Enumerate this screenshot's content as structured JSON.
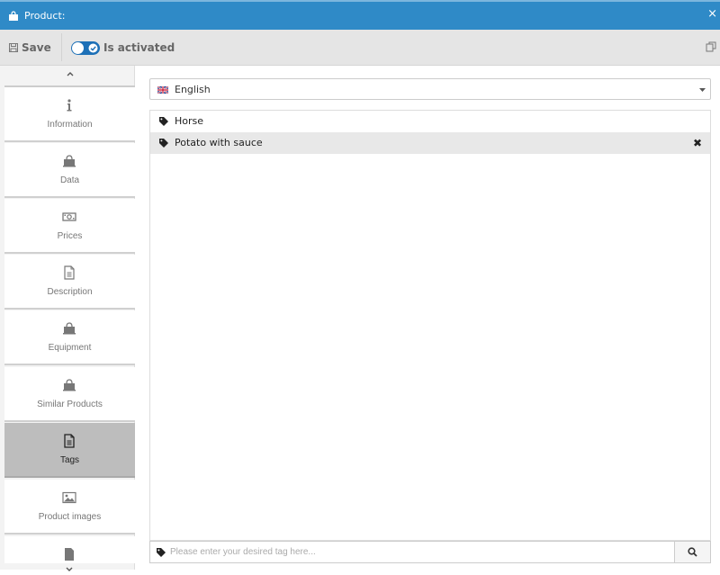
{
  "window": {
    "title": "Product:",
    "close_glyph": "×"
  },
  "toolbar": {
    "save_label": "Save",
    "is_activated": true,
    "is_activated_label": "Is activated",
    "right_icon": "copy-icon",
    "accent_color": "#1d70b7"
  },
  "sidebar": {
    "items": [
      {
        "label": "Information",
        "icon": "info-icon",
        "active": false
      },
      {
        "label": "Data",
        "icon": "shopping-bag-icon",
        "active": false
      },
      {
        "label": "Prices",
        "icon": "money-icon",
        "active": false
      },
      {
        "label": "Description",
        "icon": "document-icon",
        "active": false
      },
      {
        "label": "Equipment",
        "icon": "shopping-bag-icon",
        "active": false
      },
      {
        "label": "Similar Products",
        "icon": "shopping-bag-icon",
        "active": false
      },
      {
        "label": "Tags",
        "icon": "document-icon",
        "active": true
      },
      {
        "label": "Product images",
        "icon": "image-icon",
        "active": false
      }
    ]
  },
  "language": {
    "selected": "English",
    "flag": "uk-flag-icon"
  },
  "tags": {
    "items": [
      {
        "label": "Horse",
        "highlighted": false
      },
      {
        "label": "Potato with sauce",
        "highlighted": true,
        "remove_glyph": "✖"
      }
    ],
    "input_placeholder": "Please enter your desired tag here...",
    "input_value": ""
  },
  "colors": {
    "titlebar": "#2f8ac7",
    "active_nav": "#bdbdbd"
  }
}
